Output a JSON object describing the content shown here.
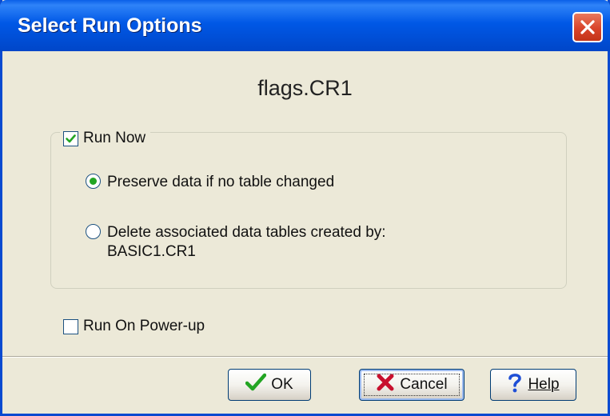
{
  "window": {
    "title": "Select Run Options"
  },
  "filename": "flags.CR1",
  "run_now": {
    "label": "Run Now",
    "checked": true
  },
  "options": [
    {
      "label_line1": "Preserve data if no table changed",
      "label_line2": "",
      "selected": true
    },
    {
      "label_line1": "Delete associated data tables created by:",
      "label_line2": "BASIC1.CR1",
      "selected": false
    }
  ],
  "run_on_powerup": {
    "label": "Run On Power-up",
    "checked": false
  },
  "buttons": {
    "ok": "OK",
    "cancel": "Cancel",
    "help": "Help"
  },
  "colors": {
    "titlebar": "#0058e6",
    "dialog_bg": "#ece9d8",
    "check_green": "#23a523",
    "cancel_red": "#c8102e",
    "help_blue": "#1f4fd6"
  },
  "icons": {
    "close": "close-icon",
    "ok": "green-checkmark-icon",
    "cancel": "red-x-icon",
    "help": "blue-question-mark-icon"
  }
}
